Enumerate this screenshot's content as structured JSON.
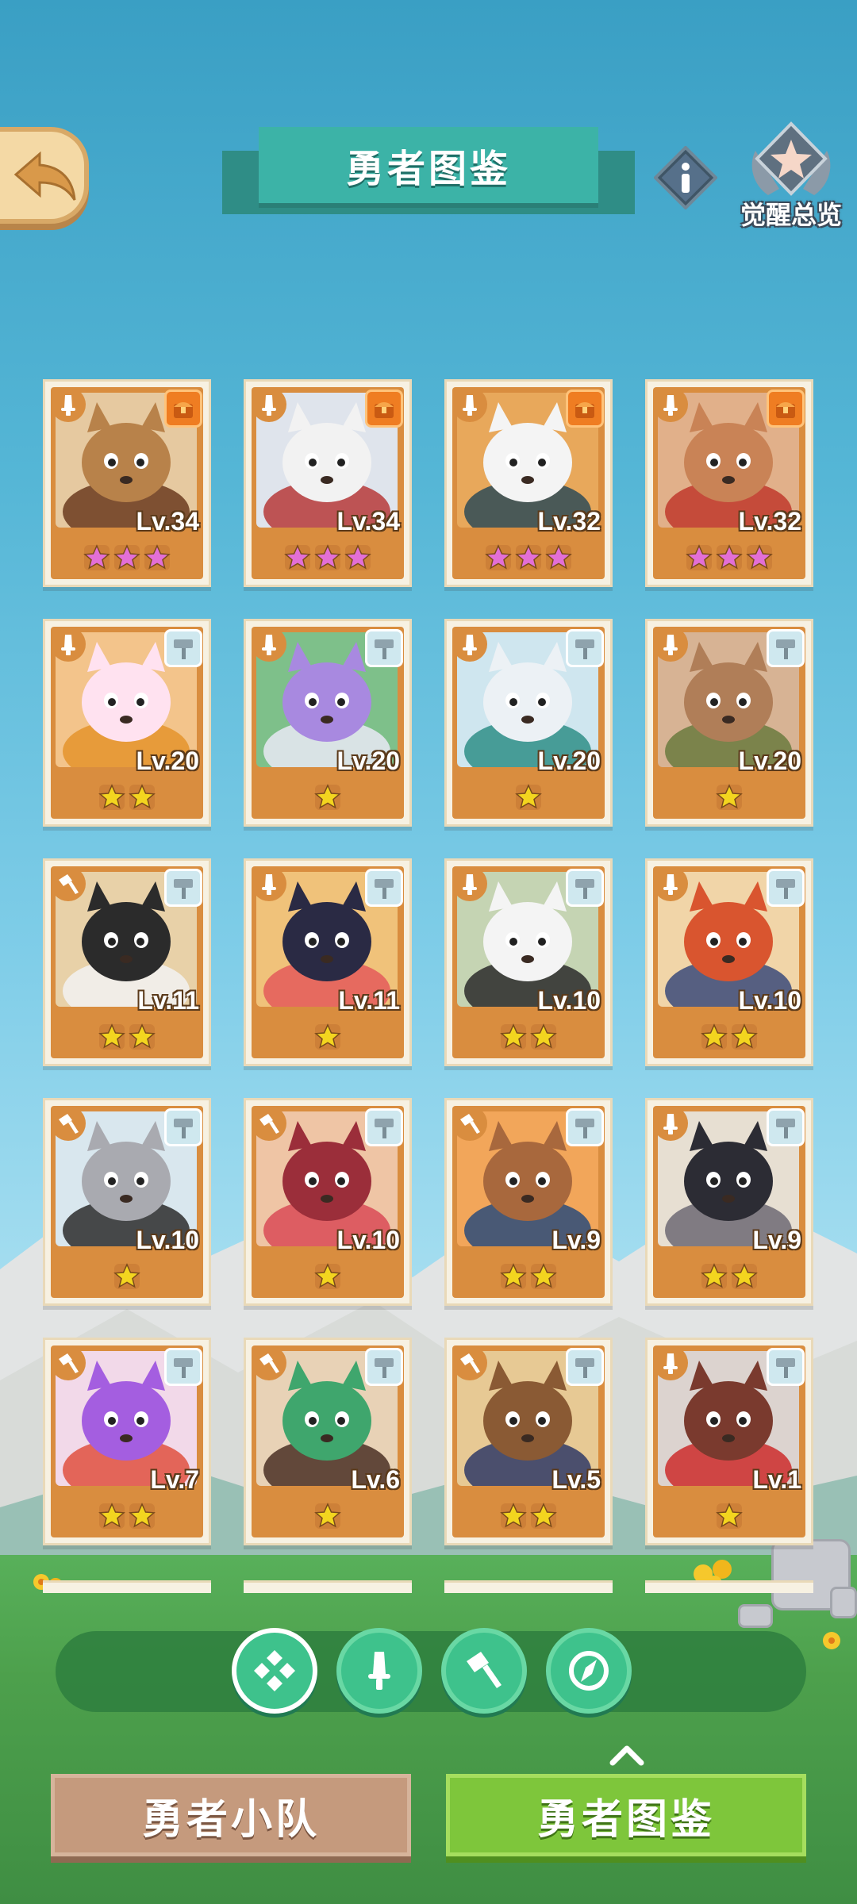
{
  "header": {
    "title": "勇者图鉴",
    "awaken_label": "觉醒总览"
  },
  "heroes": [
    {
      "level": "Lv.34",
      "stars": 3,
      "star_color": "#e36fd6",
      "class": "sword",
      "badge": "orange",
      "bg": "#e6c9a0",
      "fg": "#b8824a",
      "accent": "#6b3b1f"
    },
    {
      "level": "Lv.34",
      "stars": 3,
      "star_color": "#e36fd6",
      "class": "sword",
      "badge": "orange",
      "bg": "#dfe4ec",
      "fg": "#f2f2f2",
      "accent": "#b73a3a"
    },
    {
      "level": "Lv.32",
      "stars": 3,
      "star_color": "#e36fd6",
      "class": "sword",
      "badge": "orange",
      "bg": "#e8a85b",
      "fg": "#f4f4f4",
      "accent": "#2e4b57"
    },
    {
      "level": "Lv.32",
      "stars": 3,
      "star_color": "#e36fd6",
      "class": "sword",
      "badge": "orange",
      "bg": "#e1b08a",
      "fg": "#c98356",
      "accent": "#c0392b"
    },
    {
      "level": "Lv.20",
      "stars": 2,
      "star_color": "#f3d51f",
      "class": "sword",
      "badge": "blue",
      "bg": "#f3c48b",
      "fg": "#ffe2f0",
      "accent": "#e4942c"
    },
    {
      "level": "Lv.20",
      "stars": 1,
      "star_color": "#f3d51f",
      "class": "sword",
      "badge": "blue",
      "bg": "#7ec08a",
      "fg": "#a889e0",
      "accent": "#e9e9f5"
    },
    {
      "level": "Lv.20",
      "stars": 1,
      "star_color": "#f3d51f",
      "class": "sword",
      "badge": "blue",
      "bg": "#cfe6ef",
      "fg": "#ecf1f5",
      "accent": "#2f8e87"
    },
    {
      "level": "Lv.20",
      "stars": 1,
      "star_color": "#f3d51f",
      "class": "sword",
      "badge": "blue",
      "bg": "#d7b394",
      "fg": "#b07e58",
      "accent": "#6b7a3e"
    },
    {
      "level": "Lv.11",
      "stars": 2,
      "star_color": "#f3d51f",
      "class": "hammer",
      "badge": "blue",
      "bg": "#e8d1a8",
      "fg": "#2b2b2b",
      "accent": "#f2f2f2"
    },
    {
      "level": "Lv.11",
      "stars": 1,
      "star_color": "#f3d51f",
      "class": "sword",
      "badge": "blue",
      "bg": "#f0c27a",
      "fg": "#2a2a44",
      "accent": "#e45b5b"
    },
    {
      "level": "Lv.10",
      "stars": 2,
      "star_color": "#f3d51f",
      "class": "sword",
      "badge": "blue",
      "bg": "#c5d4b3",
      "fg": "#f4f4f4",
      "accent": "#2a2a2a"
    },
    {
      "level": "Lv.10",
      "stars": 2,
      "star_color": "#f3d51f",
      "class": "sword",
      "badge": "blue",
      "bg": "#f1d5a8",
      "fg": "#d9552f",
      "accent": "#3b4a7a"
    },
    {
      "level": "Lv.10",
      "stars": 1,
      "star_color": "#f3d51f",
      "class": "hammer",
      "badge": "blue",
      "bg": "#d9e7ee",
      "fg": "#a9aab0",
      "accent": "#2c2c2c"
    },
    {
      "level": "Lv.10",
      "stars": 1,
      "star_color": "#f3d51f",
      "class": "hammer",
      "badge": "blue",
      "bg": "#efc5a5",
      "fg": "#9b2e3a",
      "accent": "#d94a56"
    },
    {
      "level": "Lv.9",
      "stars": 2,
      "star_color": "#f3d51f",
      "class": "hammer",
      "badge": "blue",
      "bg": "#f2a65a",
      "fg": "#a8683d",
      "accent": "#2b4b7a"
    },
    {
      "level": "Lv.9",
      "stars": 2,
      "star_color": "#f3d51f",
      "class": "sword",
      "badge": "blue",
      "bg": "#e7dfd2",
      "fg": "#2c2c34",
      "accent": "#6d6a74"
    },
    {
      "level": "Lv.7",
      "stars": 2,
      "star_color": "#f3d51f",
      "class": "hammer",
      "badge": "blue",
      "bg": "#f2d9e9",
      "fg": "#a45ee0",
      "accent": "#e0503f"
    },
    {
      "level": "Lv.6",
      "stars": 1,
      "star_color": "#f3d51f",
      "class": "hammer",
      "badge": "blue",
      "bg": "#e8d2b6",
      "fg": "#3fa66d",
      "accent": "#4a3024"
    },
    {
      "level": "Lv.5",
      "stars": 2,
      "star_color": "#f3d51f",
      "class": "hammer",
      "badge": "blue",
      "bg": "#e7c994",
      "fg": "#8a5a34",
      "accent": "#2f3a66"
    },
    {
      "level": "Lv.1",
      "stars": 1,
      "star_color": "#f3d51f",
      "class": "sword",
      "badge": "blue",
      "bg": "#dcd3cf",
      "fg": "#7a3a2e",
      "accent": "#cc2b2b"
    }
  ],
  "filters": [
    {
      "icon": "all-classes-icon",
      "active": true
    },
    {
      "icon": "sword-class-icon",
      "active": false
    },
    {
      "icon": "hammer-class-icon",
      "active": false
    },
    {
      "icon": "compass-class-icon",
      "active": false
    }
  ],
  "tabs": {
    "team": "勇者小队",
    "codex": "勇者图鉴"
  }
}
